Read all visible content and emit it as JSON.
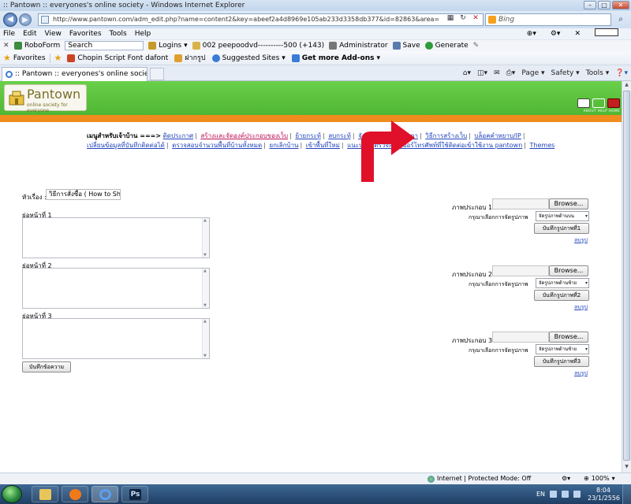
{
  "window": {
    "title": ":: Pantown :: everyones's online society - Windows Internet Explorer"
  },
  "address": {
    "url": "http://www.pantown.com/adm_edit.php?name=content2&key=abeef2a4d8969e105ab233d3358db377&id=82863&area=",
    "search_placeholder": "Bing"
  },
  "menubar": {
    "items": [
      "File",
      "Edit",
      "View",
      "Favorites",
      "Tools",
      "Help"
    ]
  },
  "toolbar": {
    "roboform": "RoboForm",
    "search": "Search",
    "logins": "Logins",
    "passcard": "002 peepoodvd----------500 (+143)",
    "administrator": "Administrator",
    "save": "Save",
    "generate": "Generate"
  },
  "favorites": {
    "label": "Favorites",
    "items": [
      "Chopin Script Font  dafont",
      "ฝากรูป",
      "Suggested Sites",
      "Get more Add-ons"
    ]
  },
  "tab": {
    "title": ":: Pantown :: everyones's online society"
  },
  "commandbar": {
    "page": "Page",
    "safety": "Safety",
    "tools": "Tools"
  },
  "site": {
    "logo_name": "Pantown",
    "logo_tagline": "online society for everyone",
    "header_icons_label": "ABOUT HELP HOME"
  },
  "nav": {
    "menu_label": "เมนูสำหรับเจ้าบ้าน ===>",
    "links_row1": [
      "ติดประกาศ",
      "สร้างและจัดองค์ประกอบของเว็บ",
      "ย้ายกระทู้",
      "ลบกระทู้",
      "จัดการหมวด",
      "ไวยดา",
      "วิธีการสร้างเว็บ",
      "บล็อคคำหยาบ/IP"
    ],
    "links_row2": [
      "เปลี่ยนข้อมูลที่บันทึกติดต่อได้",
      "ตรวจสอบจำนวนพื้นที่บ้านทั้งหมด",
      "ยกเลิกบ้าน",
      "เข้าพื้นที่ใหม่",
      "แนะนำ",
      "ตรวจสอบเบอร์โทรศัพท์ที่ใช้ติดต่อเข้าใช้งาน pantown",
      "Themes"
    ]
  },
  "form": {
    "subject_label": "หัวเรื่อง :",
    "subject_value": "วิธีการสั่งซื้อ ( How to Shop",
    "paragraphs": [
      {
        "label": "ย่อหน้าที่ 1"
      },
      {
        "label": "ย่อหน้าที่ 2"
      },
      {
        "label": "ย่อหน้าที่ 3"
      }
    ],
    "save_text_button": "บันทึกข้อความ",
    "images": [
      {
        "label": "ภาพประกอบ 1",
        "browse": "Browse...",
        "choose_label": "กรุณาเลือกการจัดรูปภาพ",
        "selected": "จัดรูปภาพด้านบน",
        "save_button": "บันทึกรูปภาพที่1",
        "delete": "ลบรูป"
      },
      {
        "label": "ภาพประกอบ 2",
        "browse": "Browse...",
        "choose_label": "กรุณาเลือกการจัดรูปภาพ",
        "selected": "จัดรูปภาพด้านซ้าย",
        "save_button": "บันทึกรูปภาพที่2",
        "delete": "ลบรูป"
      },
      {
        "label": "ภาพประกอบ 3",
        "browse": "Browse...",
        "choose_label": "กรุณาเลือกการจัดรูปภาพ",
        "selected": "จัดรูปภาพด้านซ้าย",
        "save_button": "บันทึกรูปภาพที่3",
        "delete": "ลบรูป"
      }
    ]
  },
  "status": {
    "zone": "Internet | Protected Mode: Off",
    "zoom": "100%"
  },
  "taskbar": {
    "ps_label": "Ps",
    "lang": "EN",
    "time": "8:04",
    "date": "23/1/2556"
  },
  "colors": {
    "header_green": "#5cc23e",
    "orange_strip": "#f08c1e",
    "annotation_arrow": "#e0102a"
  }
}
